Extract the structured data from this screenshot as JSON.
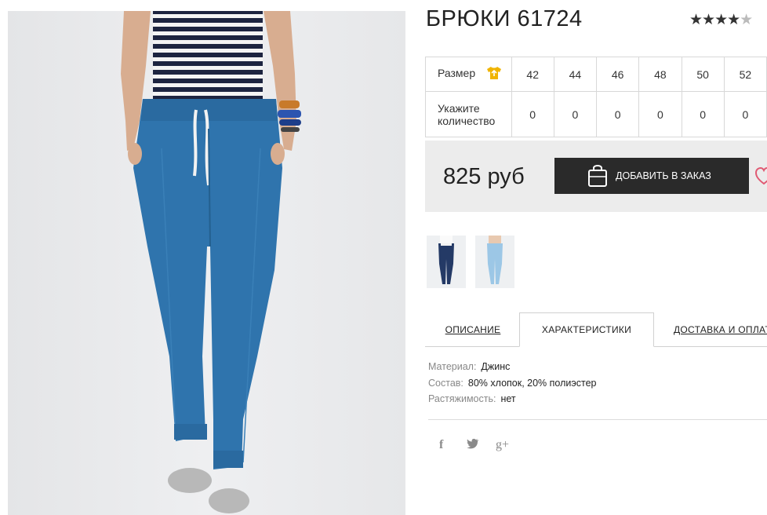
{
  "product": {
    "title": "БРЮКИ 61724",
    "rating_stars": "★★★★",
    "rating_half": "★",
    "rating_value": 4.5
  },
  "sizes": {
    "size_label": "Размер",
    "qty_label_line1": "Укажите",
    "qty_label_line2": "количество",
    "values": [
      "42",
      "44",
      "46",
      "48",
      "50",
      "52"
    ],
    "quantities": [
      "0",
      "0",
      "0",
      "0",
      "0",
      "0"
    ],
    "icon": "tshirt-size-icon",
    "icon_color": "#f0b400"
  },
  "purchase": {
    "price": "825 руб",
    "add_button_label": "ДОБАВИТЬ В ЗАКАЗ",
    "heart_color": "#e05a73"
  },
  "tabs": [
    {
      "label": "ОПИСАНИЕ",
      "active": false
    },
    {
      "label": "ХАРАКТЕРИСТИКИ",
      "active": true
    },
    {
      "label": "ДОСТАВКА И ОПЛАТА",
      "active": false
    }
  ],
  "specs": [
    {
      "key": "Материал:",
      "value": "Джинс"
    },
    {
      "key": "Состав:",
      "value": "80% хлопок, 20% полиэстер"
    },
    {
      "key": "Растяжимость:",
      "value": "нет"
    }
  ],
  "social": {
    "facebook": "f",
    "twitter": "t",
    "googleplus": "g+"
  },
  "colors": {
    "denim": "#2f74ad",
    "button_bg": "#2a2a2a",
    "price_bg": "#ececec"
  }
}
